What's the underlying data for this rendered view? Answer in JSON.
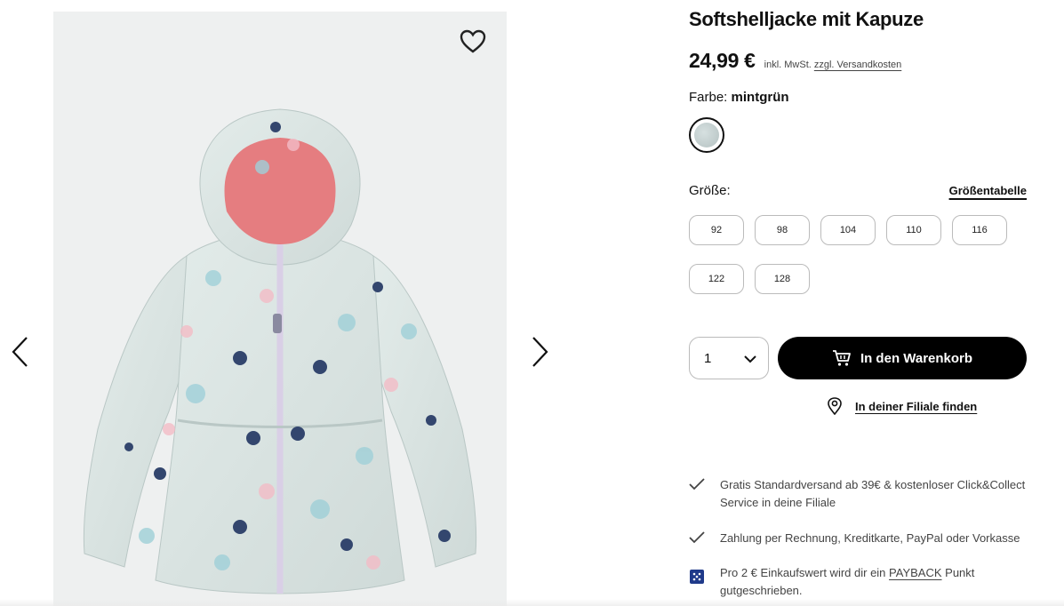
{
  "product": {
    "title": "Softshelljacke mit Kapuze",
    "price": "24,99 €",
    "vat_note": "inkl. MwSt.",
    "shipping_link": "zzgl. Versandkosten",
    "image_alt": "product-photo-jacket"
  },
  "color": {
    "label": "Farbe:",
    "value": "mintgrün",
    "swatch_color": "#c8d3d3"
  },
  "size": {
    "label": "Größe:",
    "chart_link": "Größentabelle",
    "options": [
      "92",
      "98",
      "104",
      "110",
      "116",
      "122",
      "128"
    ]
  },
  "quantity": {
    "value": "1"
  },
  "cart_button": {
    "label": "In den Warenkorb"
  },
  "store_finder": {
    "label": "In deiner Filiale finden"
  },
  "usps": {
    "shipping": "Gratis Standardversand ab 39€ & kostenloser Click&Collect Service in deine Filiale",
    "payment": "Zahlung per Rechnung, Kreditkarte, PayPal oder Vorkasse",
    "payback_prefix": "Pro 2 € Einkaufswert wird dir ein",
    "payback_link": "PAYBACK",
    "payback_suffix": "Punkt gutgeschrieben."
  },
  "colors": {
    "primary": "#000000",
    "payback_icon": "#1f3a8a",
    "image_bg": "#eef0f0"
  },
  "icons": [
    "heart-icon",
    "chevron-left-icon",
    "chevron-right-icon",
    "chevron-down-icon",
    "cart-icon",
    "location-pin-icon",
    "check-icon",
    "payback-icon"
  ]
}
